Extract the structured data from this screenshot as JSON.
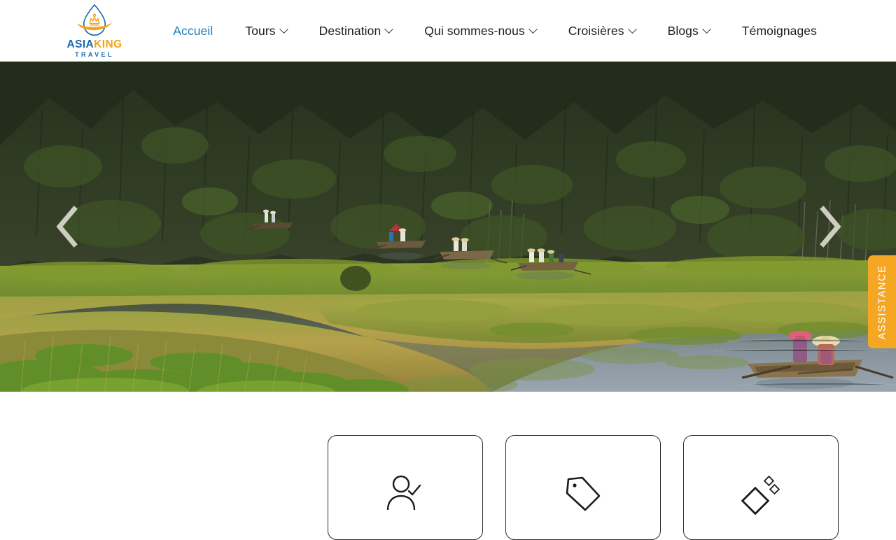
{
  "site": {
    "brand": {
      "name_part_1": "ASIA",
      "name_part_2": "KING",
      "tagline": "TRAVEL",
      "logo_icon": "water-drop-crown-logo",
      "color_blue": "#1668b3",
      "color_orange": "#f2a31c"
    }
  },
  "header": {
    "nav": [
      {
        "label": "Accueil",
        "has_dropdown": false,
        "active": true
      },
      {
        "label": "Tours",
        "has_dropdown": true,
        "active": false
      },
      {
        "label": "Destination",
        "has_dropdown": true,
        "active": false
      },
      {
        "label": "Qui sommes-nous",
        "has_dropdown": true,
        "active": false
      },
      {
        "label": "Croisières",
        "has_dropdown": true,
        "active": false
      },
      {
        "label": "Blogs",
        "has_dropdown": true,
        "active": false
      },
      {
        "label": "Témoignages",
        "has_dropdown": false,
        "active": false
      }
    ],
    "active_color": "#1a7fc1",
    "text_color": "#1d1d1d"
  },
  "hero": {
    "scene_description": "Van Long nature reserve, Vietnam — limestone karst cliffs above golden reed wetlands with small rowing boats on a winding river",
    "prev_arrow_icon": "chevron-left-icon",
    "next_arrow_icon": "chevron-right-icon",
    "arrow_color": "#e8e6dd"
  },
  "assistance": {
    "label": "ASSISTANCE",
    "background": "#f5a623",
    "text_color": "#ffffff"
  },
  "feature_cards": [
    {
      "icon": "user-check-icon",
      "icon_label": "user-with-checkmark"
    },
    {
      "icon": "price-tag-icon",
      "icon_label": "price-tag"
    },
    {
      "icon": "diamond-gem-icon",
      "icon_label": "diamond-sparkle"
    }
  ]
}
